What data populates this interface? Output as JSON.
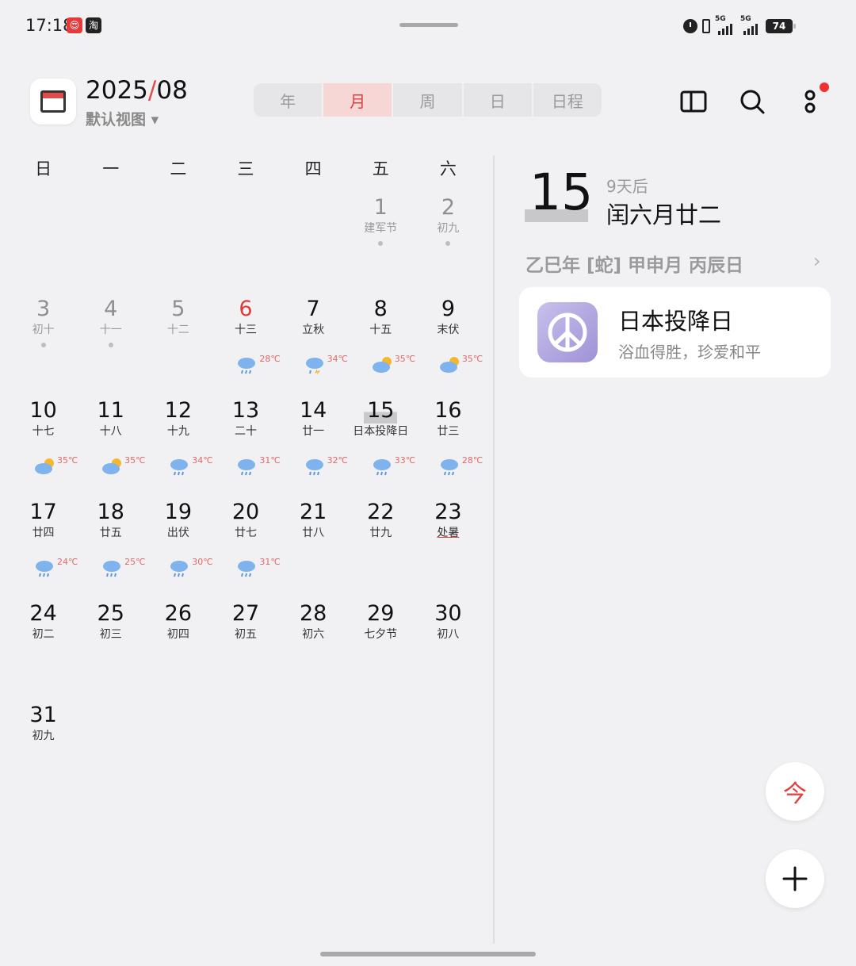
{
  "status_bar": {
    "time": "17:18",
    "app_badges": [
      "😍",
      "淘"
    ],
    "signal_labels": [
      "5G",
      "5G"
    ],
    "battery": "74"
  },
  "header": {
    "year": "2025",
    "month": "08",
    "view_selector": "默认视图 ▾",
    "tabs": [
      "年",
      "月",
      "周",
      "日",
      "日程"
    ],
    "active_tab": "月"
  },
  "weekdays": [
    "日",
    "一",
    "二",
    "三",
    "四",
    "五",
    "六"
  ],
  "calendar": {
    "rows": [
      [
        null,
        null,
        null,
        null,
        null,
        {
          "day": "1",
          "lunar": "建军节",
          "past": true,
          "dot": true
        },
        {
          "day": "2",
          "lunar": "初九",
          "past": true,
          "dot": true
        }
      ],
      [
        {
          "day": "3",
          "lunar": "初十",
          "past": true,
          "dot": true
        },
        {
          "day": "4",
          "lunar": "十一",
          "past": true,
          "dot": true
        },
        {
          "day": "5",
          "lunar": "十二",
          "past": true
        },
        {
          "day": "6",
          "lunar": "十三",
          "red": true,
          "weather": "rain",
          "temp": "28℃"
        },
        {
          "day": "7",
          "lunar": "立秋",
          "weather": "thunder",
          "temp": "34℃"
        },
        {
          "day": "8",
          "lunar": "十五",
          "weather": "partly-cloudy",
          "temp": "35℃"
        },
        {
          "day": "9",
          "lunar": "末伏",
          "weather": "partly-cloudy",
          "temp": "35℃"
        }
      ],
      [
        {
          "day": "10",
          "lunar": "十七",
          "weather": "partly-cloudy",
          "temp": "35℃"
        },
        {
          "day": "11",
          "lunar": "十八",
          "weather": "partly-cloudy",
          "temp": "35℃"
        },
        {
          "day": "12",
          "lunar": "十九",
          "weather": "rain",
          "temp": "34℃"
        },
        {
          "day": "13",
          "lunar": "二十",
          "weather": "rain",
          "temp": "31℃"
        },
        {
          "day": "14",
          "lunar": "廿一",
          "weather": "rain",
          "temp": "32℃"
        },
        {
          "day": "15",
          "lunar": "日本投降日",
          "today": true,
          "weather": "rain",
          "temp": "33℃"
        },
        {
          "day": "16",
          "lunar": "廿三",
          "weather": "rain",
          "temp": "28℃"
        }
      ],
      [
        {
          "day": "17",
          "lunar": "廿四",
          "weather": "rain",
          "temp": "24℃"
        },
        {
          "day": "18",
          "lunar": "廿五",
          "weather": "rain",
          "temp": "25℃"
        },
        {
          "day": "19",
          "lunar": "出伏",
          "weather": "rain",
          "temp": "30℃"
        },
        {
          "day": "20",
          "lunar": "廿七",
          "weather": "rain",
          "temp": "31℃"
        },
        {
          "day": "21",
          "lunar": "廿八"
        },
        {
          "day": "22",
          "lunar": "廿九"
        },
        {
          "day": "23",
          "lunar": "处暑",
          "term": true
        }
      ],
      [
        {
          "day": "24",
          "lunar": "初二"
        },
        {
          "day": "25",
          "lunar": "初三"
        },
        {
          "day": "26",
          "lunar": "初四"
        },
        {
          "day": "27",
          "lunar": "初五"
        },
        {
          "day": "28",
          "lunar": "初六"
        },
        {
          "day": "29",
          "lunar": "七夕节"
        },
        {
          "day": "30",
          "lunar": "初八"
        }
      ],
      [
        {
          "day": "31",
          "lunar": "初九"
        },
        null,
        null,
        null,
        null,
        null,
        null
      ]
    ]
  },
  "detail": {
    "day": "15",
    "days_after": "9天后",
    "lunar_date": "闰六月廿二",
    "ganzhi": "乙巳年 [蛇] 甲申月 丙辰日",
    "event": {
      "title": "日本投降日",
      "subtitle": "浴血得胜，珍爱和平",
      "icon": "peace-icon"
    }
  },
  "fab": {
    "today_label": "今"
  },
  "colors": {
    "accent": "#e04040",
    "background": "#f1f1f3"
  }
}
